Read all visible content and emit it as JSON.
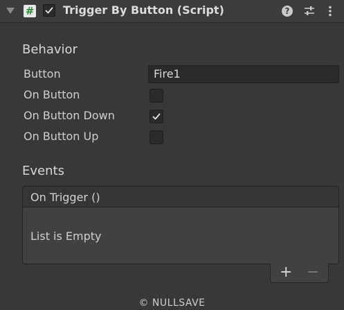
{
  "component": {
    "title": "Trigger By Button (Script)",
    "script_icon_glyph": "#",
    "enabled": true,
    "icons": [
      "foldout-arrow-icon",
      "script-icon",
      "help-icon",
      "preset-icon",
      "menu-kebab-icon"
    ]
  },
  "behavior": {
    "section_label": "Behavior",
    "button": {
      "label": "Button",
      "value": "Fire1"
    },
    "on_button": {
      "label": "On Button",
      "checked": false
    },
    "on_button_down": {
      "label": "On Button Down",
      "checked": true
    },
    "on_button_up": {
      "label": "On Button Up",
      "checked": false
    }
  },
  "events": {
    "section_label": "Events",
    "on_trigger": {
      "header": "On Trigger ()",
      "empty_text": "List is Empty",
      "add_glyph": "+",
      "remove_glyph": "−"
    }
  },
  "footer": {
    "text": "© NULLSAVE"
  },
  "colors": {
    "background": "#383838",
    "header_bg": "#3c3c3c",
    "field_bg": "#2a2a2a",
    "text": "#d2d2d2",
    "script_icon_green": "#2e8b3a"
  }
}
